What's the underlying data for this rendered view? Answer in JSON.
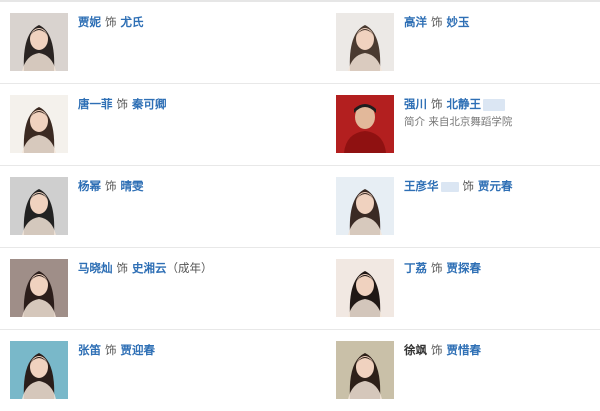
{
  "separator": "饰",
  "cast": [
    {
      "actor": "贾妮",
      "role": "尤氏",
      "photo_icon": "actress-portrait-icon",
      "photo_bg": "#d9d3cf",
      "photo_tone": "#2a2422"
    },
    {
      "actor": "高洋",
      "role": "妙玉",
      "photo_icon": "actress-portrait-icon",
      "photo_bg": "#ece9e6",
      "photo_tone": "#4a3a30"
    },
    {
      "actor": "唐一菲",
      "role": "秦可卿",
      "photo_icon": "actress-portrait-icon",
      "photo_bg": "#f4f1ec",
      "photo_tone": "#3b2a22"
    },
    {
      "actor": "强川",
      "role": "北静王",
      "intro": "简介 来自北京舞蹈学院",
      "photo_icon": "actor-portrait-icon",
      "photo_bg": "#b31f1f",
      "photo_tone": "#1e1e1e"
    },
    {
      "actor": "杨幂",
      "role": "晴雯",
      "photo_icon": "actress-portrait-icon",
      "photo_bg": "#cfcfcf",
      "photo_tone": "#222222"
    },
    {
      "actor": "王彦华",
      "role": "贾元春",
      "photo_icon": "actress-portrait-icon",
      "photo_bg": "#e7eef4",
      "photo_tone": "#3a2a24"
    },
    {
      "actor": "马晓灿",
      "role": "史湘云",
      "role_note": "（成年）",
      "photo_icon": "actress-portrait-icon",
      "photo_bg": "#9f8e88",
      "photo_tone": "#2b1d1a"
    },
    {
      "actor": "丁荔",
      "role": "贾探春",
      "photo_icon": "actress-portrait-icon",
      "photo_bg": "#f1e8e2",
      "photo_tone": "#201815"
    },
    {
      "actor": "张笛",
      "role": "贾迎春",
      "photo_icon": "actress-portrait-icon",
      "photo_bg": "#79b8c9",
      "photo_tone": "#2a1e1a"
    },
    {
      "actor": "徐飒",
      "role": "贾惜春",
      "photo_icon": "actress-portrait-icon",
      "photo_bg": "#c9c0a8",
      "photo_tone": "#2d2019"
    }
  ]
}
